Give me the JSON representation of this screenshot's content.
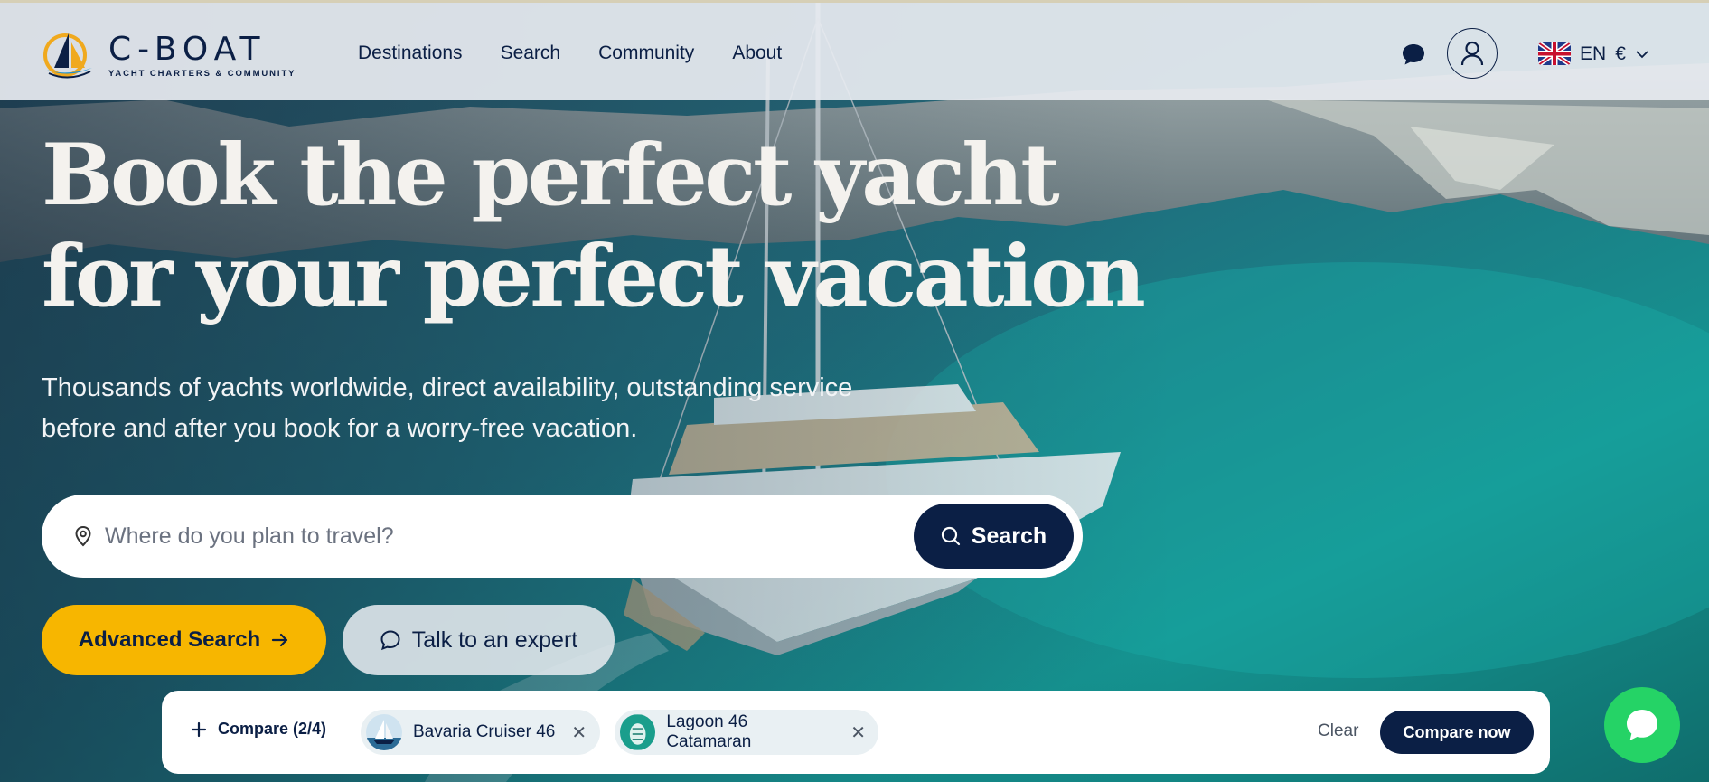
{
  "brand": {
    "name": "C-BOAT",
    "tagline": "YACHT CHARTERS & COMMUNITY",
    "logo_icon": "sailboat-logo-icon",
    "navy": "#0b1f45",
    "yellow": "#f7b600",
    "whatsapp_green": "#25d366"
  },
  "nav": {
    "items": [
      {
        "label": "Destinations"
      },
      {
        "label": "Search"
      },
      {
        "label": "Community"
      },
      {
        "label": "About"
      }
    ],
    "chat_icon": "chat-bubble-icon",
    "user_icon": "user-icon",
    "language": {
      "flag": "uk-flag-icon",
      "code": "EN",
      "currency": "€",
      "chevron": "chevron-down-icon"
    }
  },
  "hero": {
    "headline_line1": "Book the perfect yacht",
    "headline_line2": "for your perfect vacation",
    "subtitle": "Thousands of yachts worldwide, direct availability, outstanding service before and after you book for a worry-free vacation."
  },
  "search": {
    "placeholder": "Where do you plan to travel?",
    "value": "",
    "button_label": "Search",
    "pin_icon": "location-pin-icon",
    "search_icon": "search-icon"
  },
  "actions": {
    "advanced_label": "Advanced Search",
    "expert_label": "Talk to an expert"
  },
  "compare": {
    "toggle_label": "Compare (2/4)",
    "items": [
      {
        "name": "Bavaria Cruiser 46"
      },
      {
        "name": "Lagoon 46 Catamaran"
      }
    ],
    "clear_label": "Clear",
    "compare_now_label": "Compare now"
  },
  "whatsapp": {
    "icon": "whatsapp-icon"
  }
}
